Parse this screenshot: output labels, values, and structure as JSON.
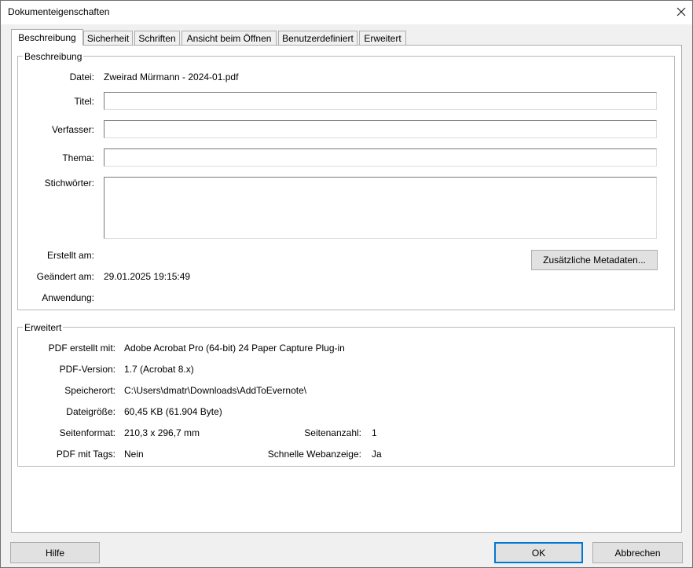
{
  "window": {
    "title": "Dokumenteigenschaften",
    "close_icon": "close-icon"
  },
  "tabs": [
    {
      "label": "Beschreibung",
      "active": true
    },
    {
      "label": "Sicherheit"
    },
    {
      "label": "Schriften"
    },
    {
      "label": "Ansicht beim Öffnen"
    },
    {
      "label": "Benutzerdefiniert"
    },
    {
      "label": "Erweitert"
    }
  ],
  "description": {
    "legend": "Beschreibung",
    "file_label": "Datei:",
    "file_value": "Zweirad Mürmann - 2024-01.pdf",
    "title_label": "Titel:",
    "title_value": "",
    "author_label": "Verfasser:",
    "author_value": "",
    "subject_label": "Thema:",
    "subject_value": "",
    "keywords_label": "Stichwörter:",
    "keywords_value": "",
    "created_label": "Erstellt am:",
    "created_value": "",
    "modified_label": "Geändert am:",
    "modified_value": "29.01.2025 19:15:49",
    "application_label": "Anwendung:",
    "application_value": "",
    "metadata_button": "Zusätzliche Metadaten..."
  },
  "advanced": {
    "legend": "Erweitert",
    "producer_label": "PDF erstellt mit:",
    "producer_value": "Adobe Acrobat Pro (64-bit) 24 Paper Capture Plug-in",
    "version_label": "PDF-Version:",
    "version_value": "1.7 (Acrobat 8.x)",
    "location_label": "Speicherort:",
    "location_value": "C:\\Users\\dmatr\\Downloads\\AddToEvernote\\",
    "size_label": "Dateigröße:",
    "size_value": "60,45 KB (61.904 Byte)",
    "page_size_label": "Seitenformat:",
    "page_size_value": "210,3 x 296,7 mm",
    "page_count_label": "Seitenanzahl:",
    "page_count_value": "1",
    "tagged_label": "PDF mit Tags:",
    "tagged_value": "Nein",
    "fast_web_label": "Schnelle Webanzeige:",
    "fast_web_value": "Ja"
  },
  "footer": {
    "help": "Hilfe",
    "ok": "OK",
    "cancel": "Abbrechen"
  }
}
